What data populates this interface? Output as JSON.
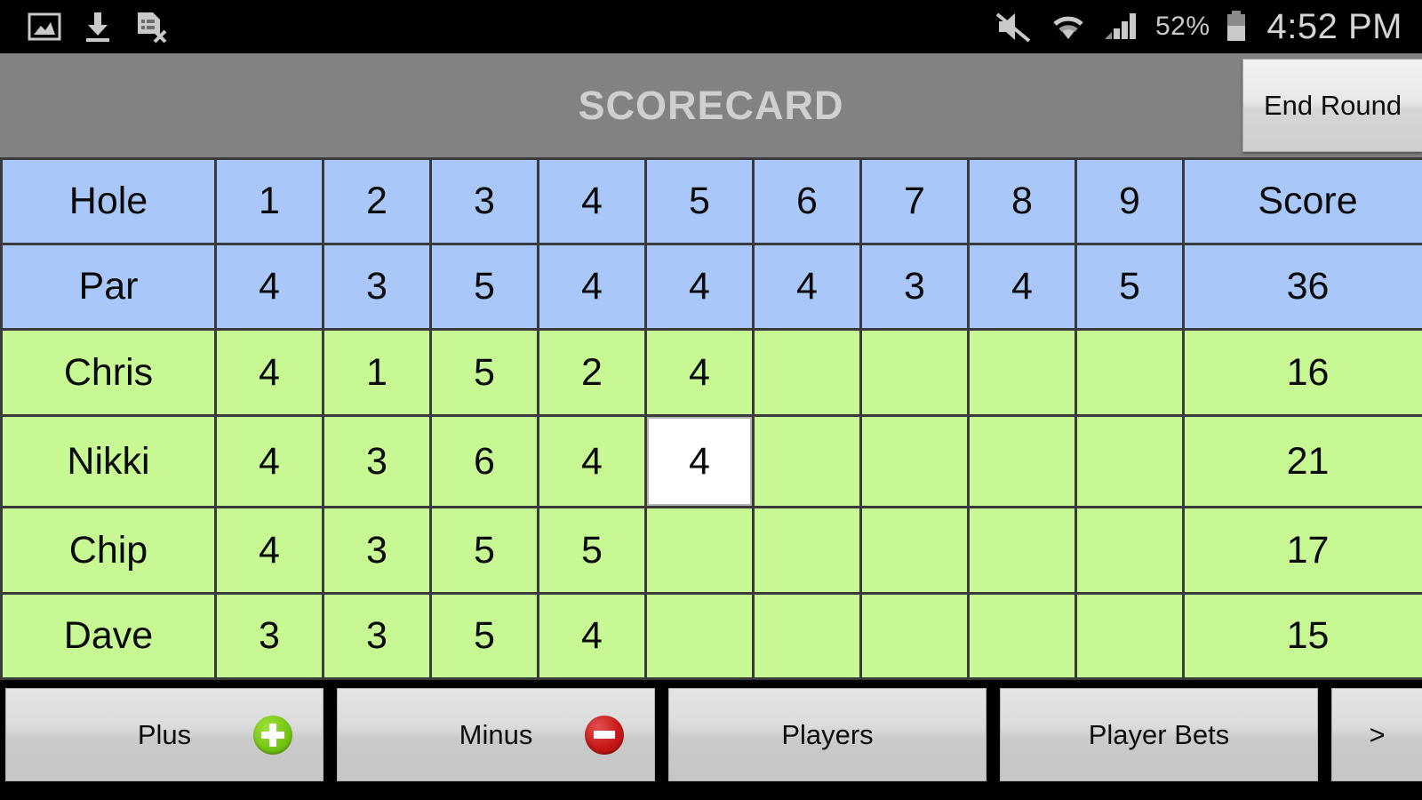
{
  "status_bar": {
    "left_icons": [
      "screenshot-image-icon",
      "download-icon",
      "document-removed-icon"
    ],
    "right_icons": [
      "mute-icon",
      "wifi-icon",
      "cellular-signal-icon",
      "battery-icon"
    ],
    "battery_percent": "52%",
    "clock": "4:52 PM"
  },
  "header": {
    "title": "SCORECARD",
    "end_round_label": "End Round"
  },
  "table": {
    "row_header_label": "Hole",
    "par_label": "Par",
    "score_label": "Score",
    "holes": [
      "1",
      "2",
      "3",
      "4",
      "5",
      "6",
      "7",
      "8",
      "9"
    ],
    "par": [
      "4",
      "3",
      "5",
      "4",
      "4",
      "4",
      "3",
      "4",
      "5"
    ],
    "par_total": "36",
    "players": [
      {
        "name": "Chris",
        "scores": [
          "4",
          "1",
          "5",
          "2",
          "4",
          "",
          "",
          "",
          ""
        ],
        "total": "16"
      },
      {
        "name": "Nikki",
        "scores": [
          "4",
          "3",
          "6",
          "4",
          "4",
          "",
          "",
          "",
          ""
        ],
        "total": "21"
      },
      {
        "name": "Chip",
        "scores": [
          "4",
          "3",
          "5",
          "5",
          "",
          "",
          "",
          "",
          ""
        ],
        "total": "17"
      },
      {
        "name": "Dave",
        "scores": [
          "3",
          "3",
          "5",
          "4",
          "",
          "",
          "",
          "",
          ""
        ],
        "total": "15"
      }
    ],
    "selected_cell": {
      "player": "Nikki",
      "hole": "5",
      "value": "4"
    }
  },
  "buttons": {
    "plus": "Plus",
    "minus": "Minus",
    "players": "Players",
    "player_bets": "Player Bets",
    "next": ">"
  },
  "colors": {
    "header_blue": "#a9c8f9",
    "player_green": "#c8f894",
    "selected_white": "#ffffff",
    "grid": "#3a3a3a",
    "title_bar": "#828282",
    "plus_icon": "#77c716",
    "minus_icon": "#c81818"
  }
}
